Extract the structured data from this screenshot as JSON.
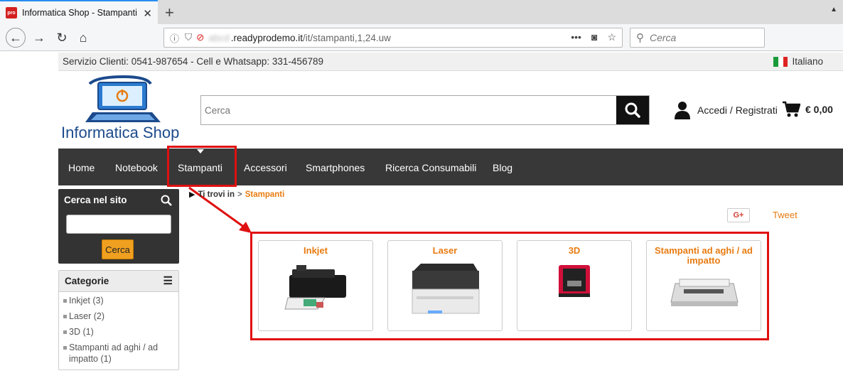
{
  "browser": {
    "tab_title": "Informatica Shop - Stampanti",
    "favicon_text": "pro",
    "url_host": ".readyprodemo.it",
    "url_path": "/it/stampanti,1,24.uw",
    "search_placeholder": "Cerca"
  },
  "topbar": {
    "service_text": "Servizio Clienti: 0541-987654 - Cell e Whatsapp: 331-456789",
    "language": "Italiano"
  },
  "header": {
    "logo_text": "Informatica Shop",
    "search_placeholder": "Cerca",
    "account_label": "Accedi / Registrati",
    "cart_total": "€ 0,00"
  },
  "nav": {
    "items": [
      {
        "label": "Home"
      },
      {
        "label": "Notebook"
      },
      {
        "label": "Stampanti"
      },
      {
        "label": "Accessori"
      },
      {
        "label": "Smartphones"
      },
      {
        "label": "Ricerca Consumabili"
      },
      {
        "label": "Blog"
      }
    ],
    "active": "Stampanti"
  },
  "sidebar": {
    "search_title": "Cerca nel sito",
    "search_button": "Cerca",
    "categories_title": "Categorie",
    "categories": [
      {
        "label": "Inkjet (3)"
      },
      {
        "label": "Laser (2)"
      },
      {
        "label": "3D (1)"
      },
      {
        "label": "Stampanti ad aghi / ad impatto (1)"
      }
    ]
  },
  "breadcrumb": {
    "prefix": "Ti trovi in",
    "separator": ">",
    "current": "Stampanti"
  },
  "social": {
    "gplus": "G+",
    "tweet": "Tweet"
  },
  "products": [
    {
      "title": "Inkjet"
    },
    {
      "title": "Laser"
    },
    {
      "title": "3D"
    },
    {
      "title": "Stampanti ad aghi / ad impatto"
    }
  ],
  "colors": {
    "accent": "#e87b10",
    "nav_bg": "#383838",
    "highlight": "#e01010"
  }
}
